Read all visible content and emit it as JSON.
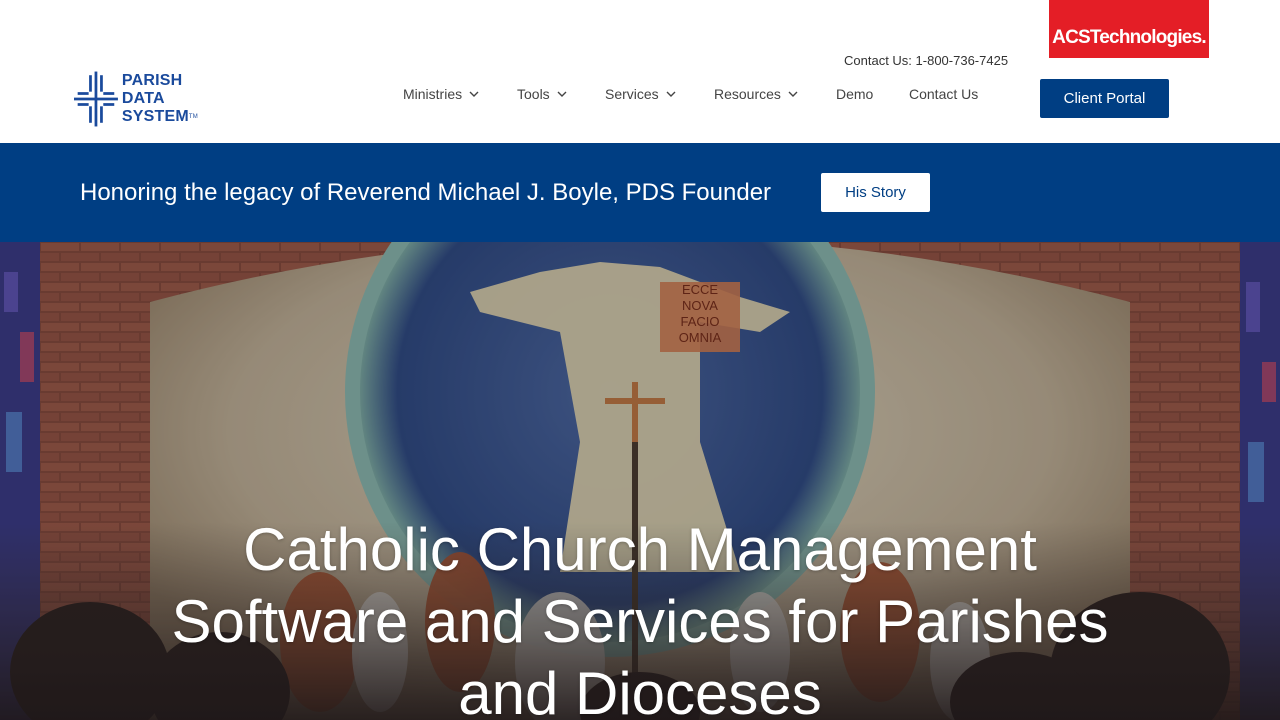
{
  "header": {
    "logo": {
      "line1": "Parish",
      "line2": "Data",
      "line3": "System",
      "trademark": "TM"
    },
    "partner_badge": "ACSTechnologies.",
    "contact": "Contact Us: 1-800-736-7425",
    "nav": [
      {
        "label": "Ministries",
        "has_dropdown": true
      },
      {
        "label": "Tools",
        "has_dropdown": true
      },
      {
        "label": "Services",
        "has_dropdown": true
      },
      {
        "label": "Resources",
        "has_dropdown": true
      },
      {
        "label": "Demo",
        "has_dropdown": false
      },
      {
        "label": "Contact Us",
        "has_dropdown": false
      }
    ],
    "client_portal_label": "Client Portal"
  },
  "banner": {
    "text": "Honoring the legacy of Reverend Michael J. Boyle, PDS Founder",
    "button_label": "His Story"
  },
  "hero": {
    "title": "Catholic Church Management Software and Services for Parishes and Dioceses",
    "mosaic_text": [
      "ECCE",
      "NOVA",
      "FACIO",
      "OMNIA"
    ]
  },
  "colors": {
    "brand_blue": "#003e83",
    "logo_blue": "#1a4a9c",
    "acs_red": "#e41e26"
  }
}
